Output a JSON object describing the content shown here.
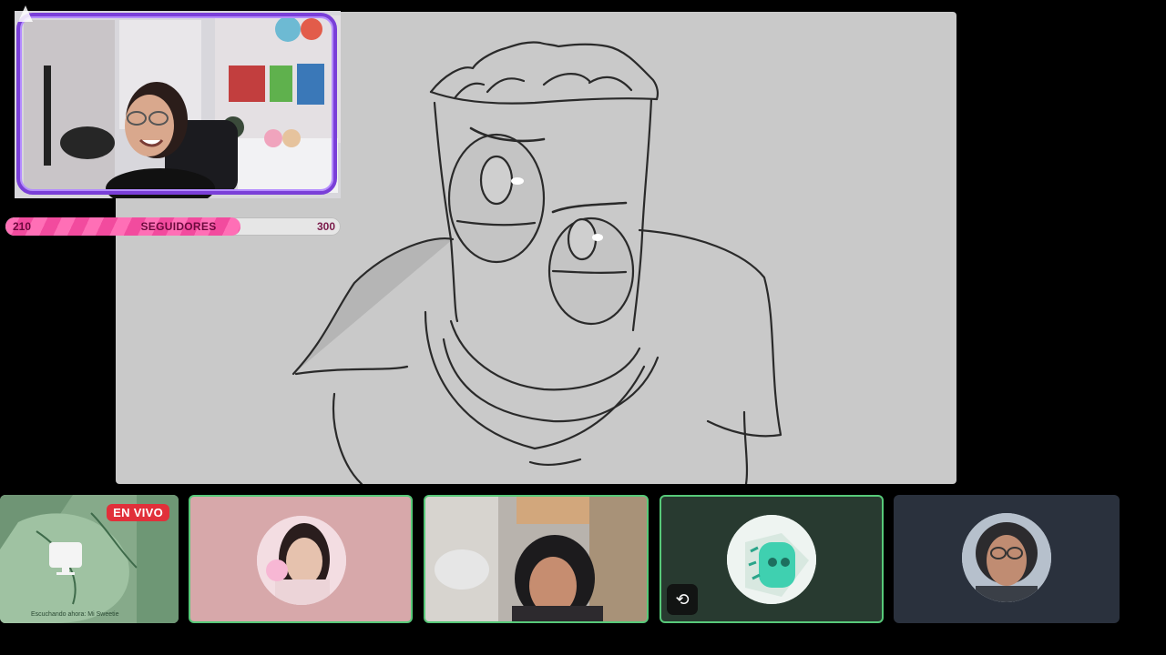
{
  "overlay": {
    "followers": {
      "label": "SEGUIDORES",
      "current": "210",
      "goal": "300",
      "progress_fraction": 0.7
    },
    "frame_color": "#7a3fd8",
    "bar_color": "#f24b9e"
  },
  "participants": [
    {
      "live_badge": "EN VIVO",
      "caption": "Escuchando ahora: Mi Sweetie",
      "icon": "screen-share-icon"
    },
    {
      "icon": "avatar"
    },
    {
      "icon": "video"
    },
    {
      "icon": "avatar",
      "status_icon": "stream-icon"
    },
    {
      "icon": "avatar"
    }
  ],
  "colors": {
    "speaking_border": "#57c979",
    "live_red": "#e1303a",
    "canvas_bg": "#c9c9c9"
  }
}
